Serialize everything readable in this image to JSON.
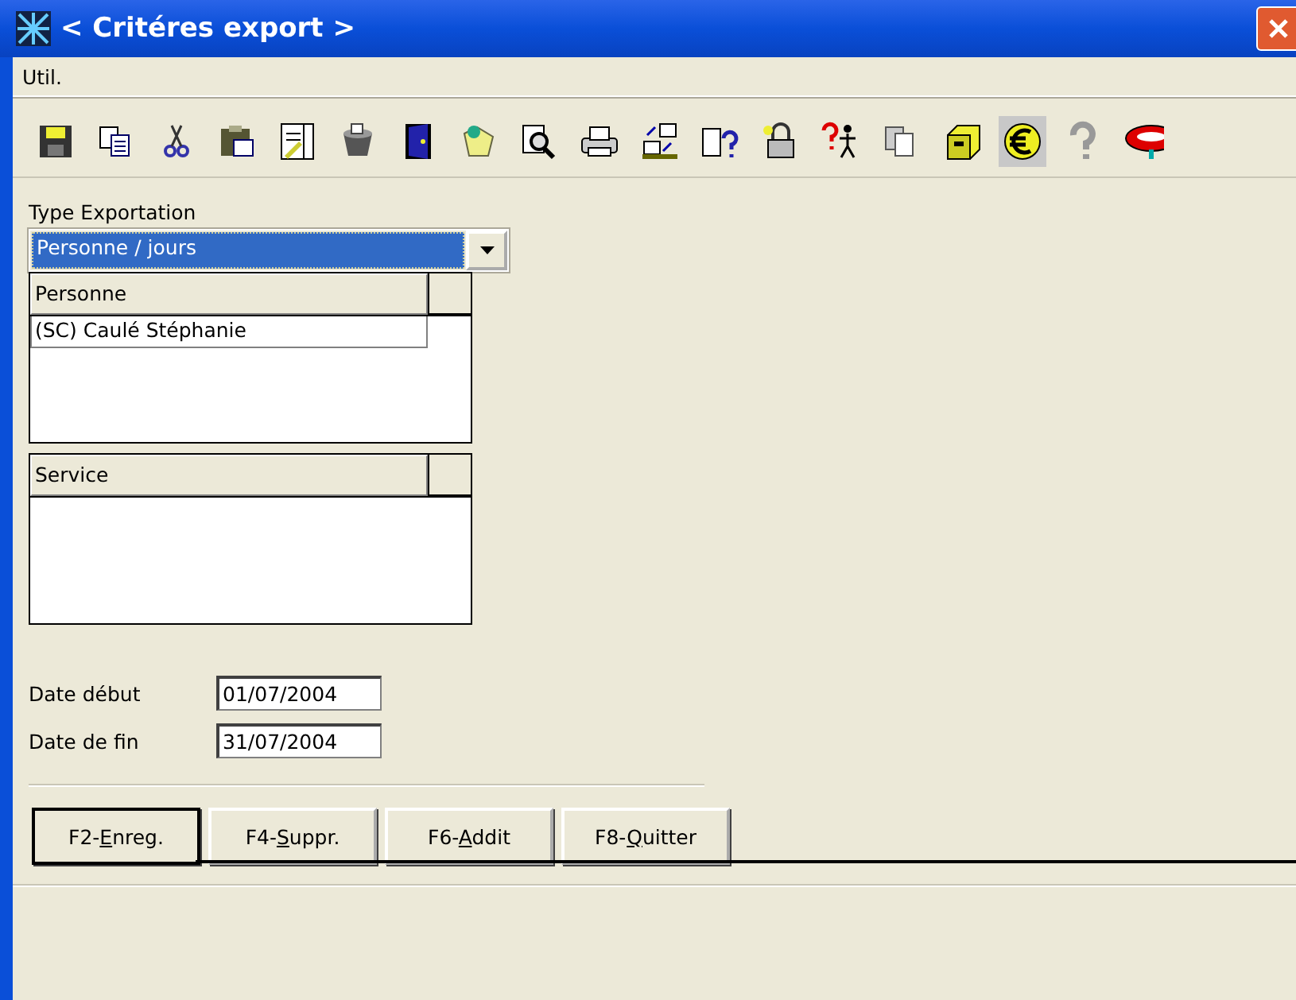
{
  "window": {
    "title": "< Critéres export >"
  },
  "menu": [
    "Util."
  ],
  "toolbar": [
    {
      "selected": false
    },
    {
      "selected": false
    },
    {
      "selected": false
    },
    {
      "selected": false
    },
    {
      "selected": false
    },
    {
      "selected": false
    },
    {
      "selected": false
    },
    {
      "selected": false
    },
    {
      "selected": false
    },
    {
      "selected": false
    },
    {
      "selected": false
    },
    {
      "selected": false
    },
    {
      "selected": false
    },
    {
      "selected": false
    },
    {
      "selected": false
    },
    {
      "selected": false
    },
    {
      "selected": true
    },
    {
      "selected": false
    },
    {
      "selected": false
    }
  ],
  "type_exportation": {
    "label": "Type Exportation",
    "value": "Personne / jours"
  },
  "grids": [
    {
      "column": "Personne",
      "rows": [
        "(SC) Caulé Stéphanie"
      ]
    },
    {
      "column": "Service"
    }
  ],
  "dates": [
    {
      "label": "Date début",
      "value": "01/07/2004"
    },
    {
      "label": "Date de fin",
      "value": "31/07/2004"
    }
  ],
  "buttons": [
    {
      "prefix": "F2-",
      "mnemonic": "E",
      "suffix": "nreg.",
      "focused": true
    },
    {
      "prefix": "F4-",
      "mnemonic": "S",
      "suffix": "uppr.",
      "focused": false
    },
    {
      "prefix": "F6-",
      "mnemonic": "A",
      "suffix": "ddit",
      "focused": false
    },
    {
      "prefix": "F8-",
      "mnemonic": "Q",
      "suffix": "uitter",
      "focused": false
    }
  ]
}
